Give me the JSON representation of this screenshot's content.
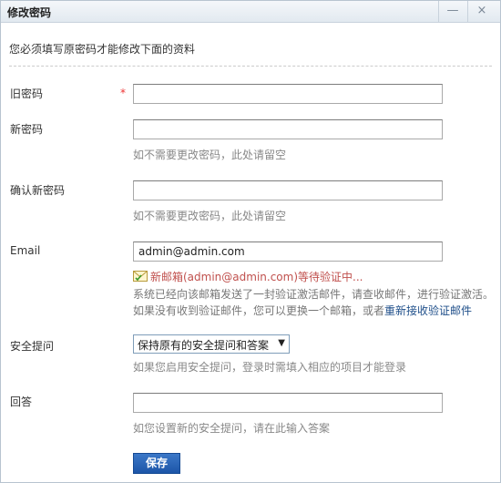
{
  "dialog": {
    "title": "修改密码",
    "minimize_label": "—",
    "close_label": "×"
  },
  "intro": "您必须填写原密码才能修改下面的资料",
  "form": {
    "old_password": {
      "label": "旧密码",
      "required_mark": "*",
      "value": ""
    },
    "new_password": {
      "label": "新密码",
      "value": "",
      "hint": "如不需要更改密码，此处请留空"
    },
    "confirm_password": {
      "label": "确认新密码",
      "value": "",
      "hint": "如不需要更改密码，此处请留空"
    },
    "email": {
      "label": "Email",
      "value": "admin@admin.com",
      "pending_text": "新邮箱(admin@admin.com)等待验证中...",
      "notice_line1": "系统已经向该邮箱发送了一封验证激活邮件，请查收邮件，进行验证激活。",
      "notice_line2": "如果没有收到验证邮件，您可以更换一个邮箱，或者",
      "resend_link": "重新接收验证邮件"
    },
    "security_question": {
      "label": "安全提问",
      "selected": "保持原有的安全提问和答案",
      "hint": "如果您启用安全提问，登录时需填入相应的项目才能登录"
    },
    "answer": {
      "label": "回答",
      "value": "",
      "hint": "如您设置新的安全提问，请在此输入答案"
    },
    "save_label": "保存"
  }
}
